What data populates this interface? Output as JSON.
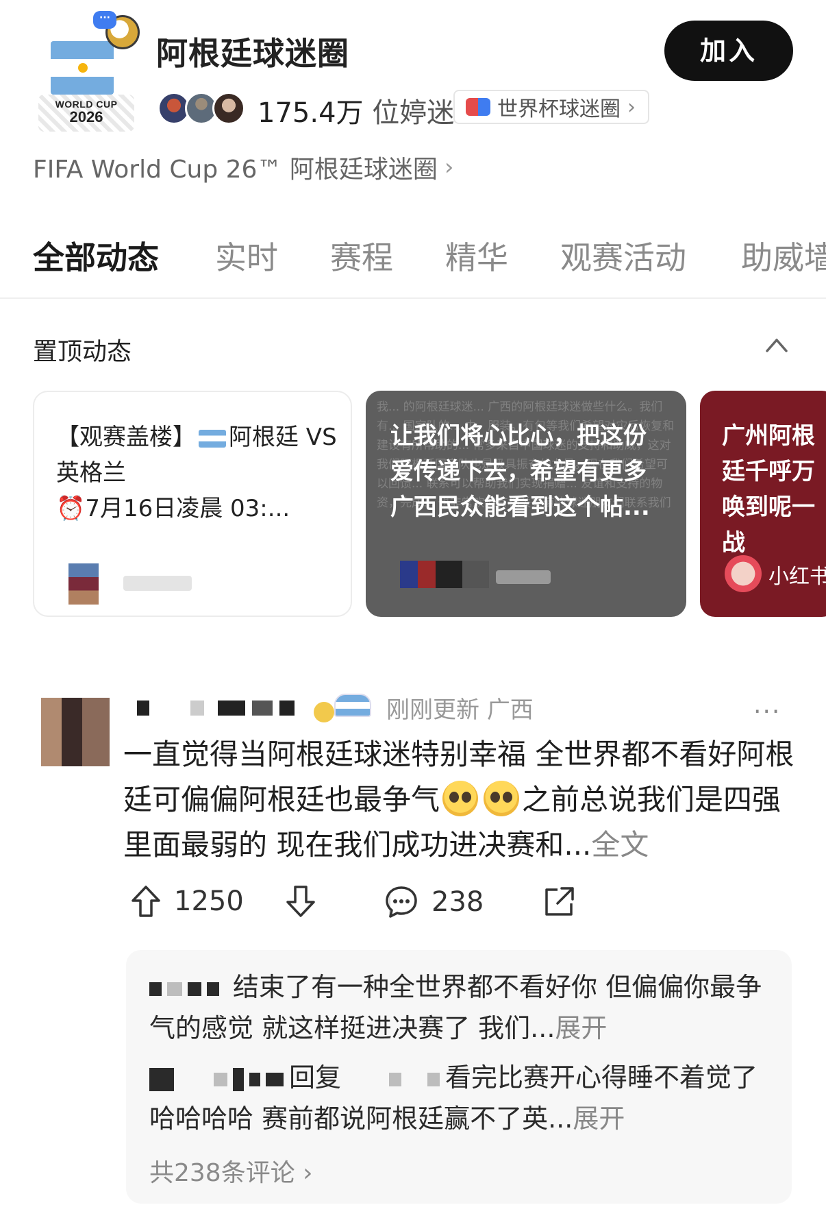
{
  "circle": {
    "logo_line1": "WORLD CUP",
    "logo_line2": "2026",
    "title": "阿根廷球迷圈",
    "join_label": "加入",
    "fan_count": "175.4万",
    "fan_unit": "位婷迷",
    "parent_circle": "世界杯球迷圈",
    "description": "FIFA World Cup 26™ 阿根廷球迷圈"
  },
  "tabs": [
    {
      "label": "全部动态",
      "active": true
    },
    {
      "label": "实时",
      "active": false
    },
    {
      "label": "赛程",
      "active": false
    },
    {
      "label": "精华",
      "active": false
    },
    {
      "label": "观赛活动",
      "active": false
    },
    {
      "label": "助威墙",
      "active": false
    }
  ],
  "pinned": {
    "title": "置顶动态",
    "cards": [
      {
        "text_part1": "【观赛盖楼】",
        "text_part2": "阿根廷 VS 英格兰",
        "text_part3": "⏰7月16日凌晨 03:..."
      },
      {
        "text": "让我们将心比心，把这份爱传递下去，希望有更多广西民众能看到这个帖..."
      },
      {
        "text": "广州阿根廷千呼万唤到呢一战",
        "author": "小红书"
      }
    ],
    "card2_background_text": "我... 的阿根廷球迷... 广西的阿根廷球迷做些什么。我们有... 国家队的... 巾、服装。有包等我们希望对灾后恢复和建设有所帮助的... 常多来自中国球迷的支持和助威，这对我们阿根廷国家队也是极具振奋的力量。现在我们希望可以回馈... 联系可以帮助我们实现捐赠... 友谊和支持的物资，完成... 也非常欢迎有相关渠道的球迷朋友们联系我们"
  },
  "post": {
    "updated": "刚刚更新",
    "location": "广西",
    "text_a": "一直觉得当阿根廷球迷特别幸福  全世界都不看好阿根廷可偏偏阿根廷也最争气",
    "text_b": "之前总说我们是四强里面最弱的  现在我们成功进决赛和...",
    "full_label": "全文",
    "upvotes": "1250",
    "comments": "238",
    "icons": [
      "upvote-icon",
      "downvote-icon",
      "comment-icon",
      "share-icon"
    ]
  },
  "comments": {
    "c1_text": "结束了有一种全世界都不看好你  但偏偏你最争气的感觉  就这样挺进决赛了  我们...",
    "c1_expand": "展开",
    "c2_reply": "回复",
    "c2_text": "看完比赛开心得睡不着觉了哈哈哈哈  赛前都说阿根廷赢不了英...",
    "c2_expand": "展开",
    "total": "共238条评论",
    "chevron": "›"
  }
}
